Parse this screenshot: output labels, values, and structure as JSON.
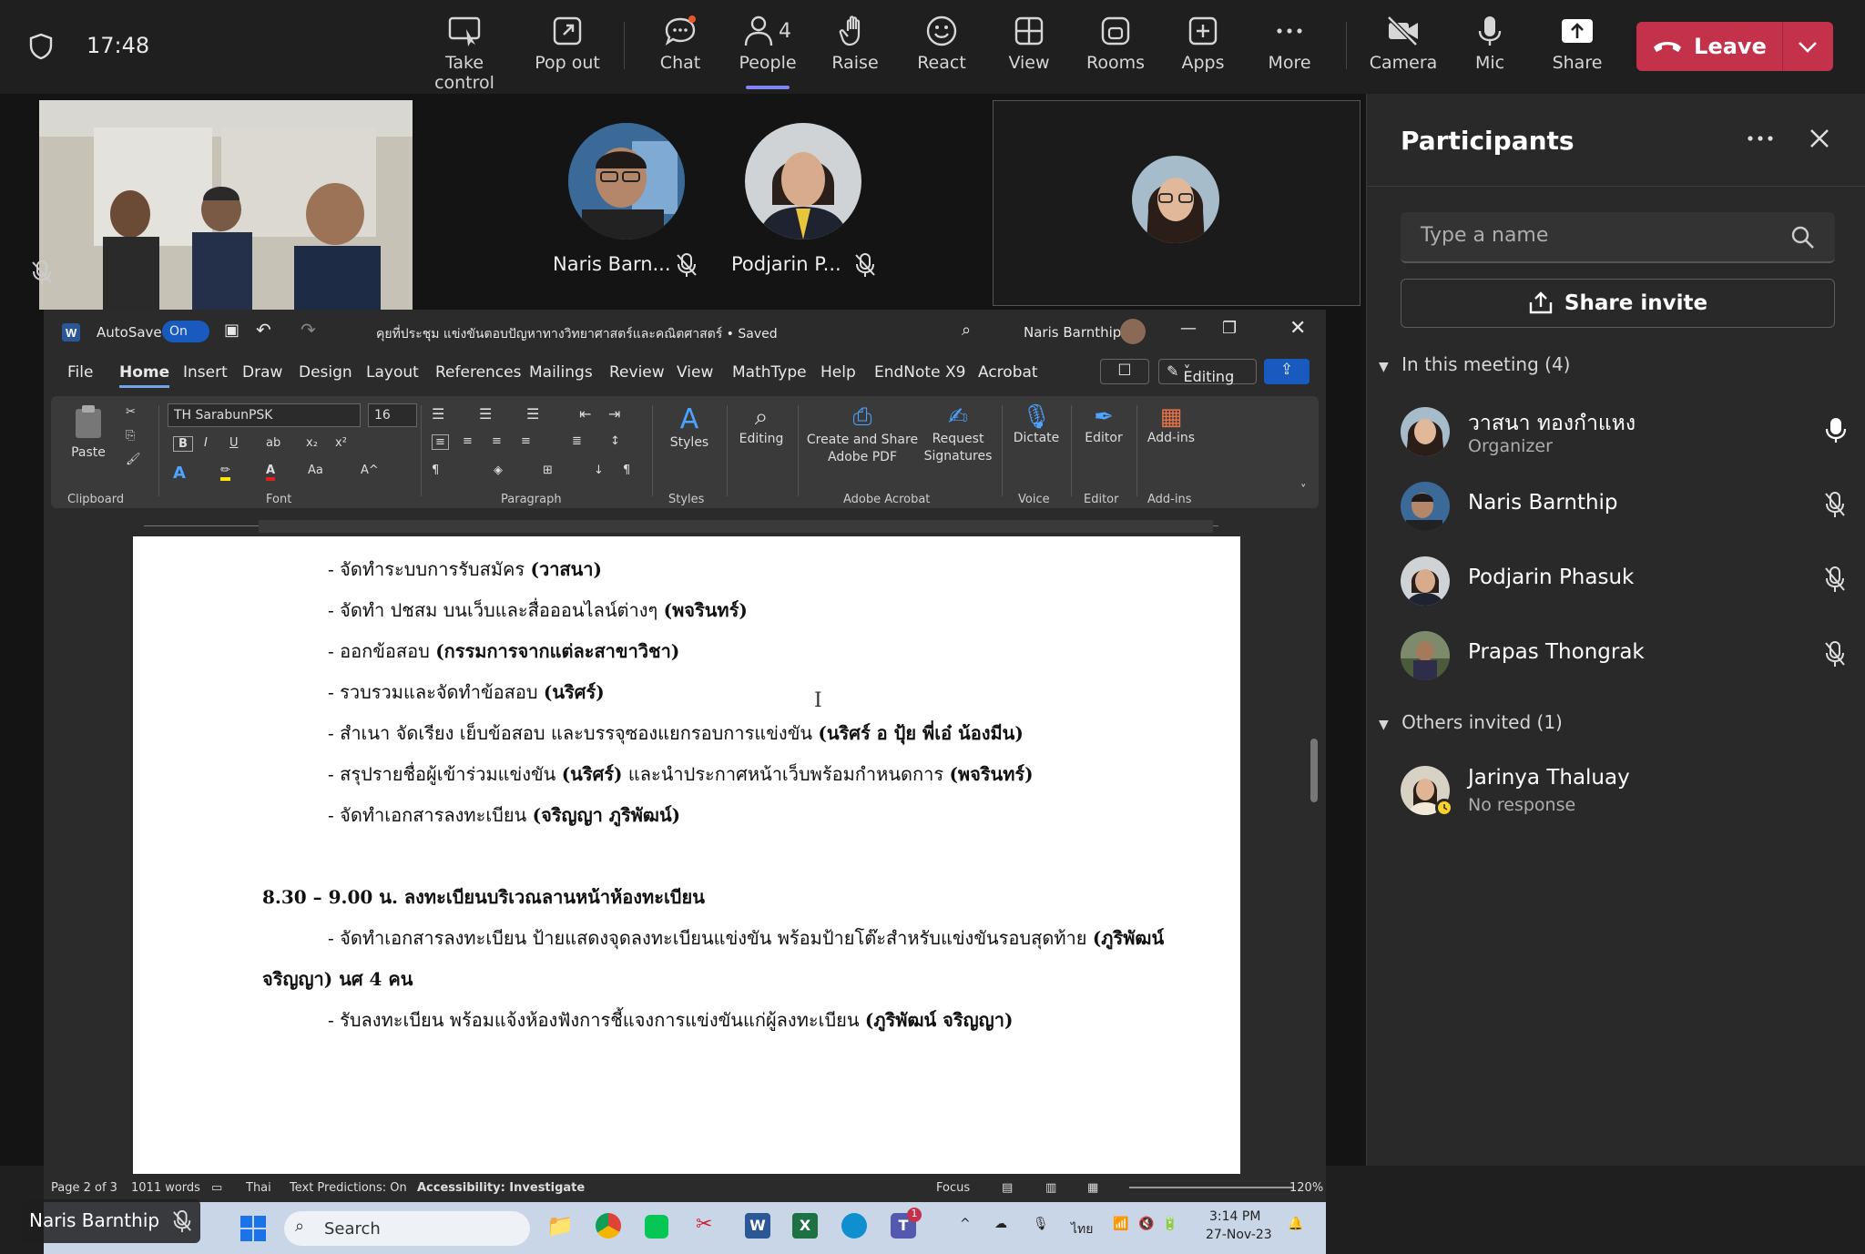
{
  "topbar": {
    "time": "17:48",
    "buttons": [
      {
        "label": "Take control",
        "icon": "take-control-icon"
      },
      {
        "label": "Pop out",
        "icon": "pop-out-icon"
      },
      {
        "label": "Chat",
        "icon": "chat-icon"
      },
      {
        "label": "People",
        "icon": "people-icon",
        "count": "4",
        "selected": true
      },
      {
        "label": "Raise",
        "icon": "raise-hand-icon"
      },
      {
        "label": "React",
        "icon": "react-icon"
      },
      {
        "label": "View",
        "icon": "view-icon"
      },
      {
        "label": "Rooms",
        "icon": "rooms-icon"
      },
      {
        "label": "Apps",
        "icon": "apps-icon"
      },
      {
        "label": "More",
        "icon": "more-icon"
      },
      {
        "label": "Camera",
        "icon": "camera-off-icon"
      },
      {
        "label": "Mic",
        "icon": "mic-icon"
      },
      {
        "label": "Share",
        "icon": "share-icon"
      }
    ],
    "leave_label": "Leave",
    "colors": {
      "leave": "#c4314b",
      "accent": "#7f85f5"
    }
  },
  "stage": {
    "tiles": [
      {
        "name": "Naris Barn..."
      },
      {
        "name": "Podjarin P..."
      }
    ],
    "presenter_badge": "Naris Barnthip"
  },
  "word": {
    "autosave_label": "AutoSave",
    "autosave_state": "On",
    "doc_title": "คุยที่ประชุม แข่งขันตอบปัญหาทางวิทยาศาสตร์และคณิตศาสตร์ • Saved",
    "user_name": "Naris Barnthip",
    "menu": [
      "File",
      "Home",
      "Insert",
      "Draw",
      "Design",
      "Layout",
      "References",
      "Mailings",
      "Review",
      "View",
      "MathType",
      "Help",
      "EndNote X9",
      "Acrobat"
    ],
    "editing_label": "Editing",
    "font_name": "TH SarabunPSK",
    "font_size": "16",
    "ribbon": {
      "paste": "Paste",
      "styles": "Styles",
      "editing": "Editing",
      "create_pdf": "Create and Share Adobe PDF",
      "request_sig": "Request Signatures",
      "dictate": "Dictate",
      "editor": "Editor",
      "addins": "Add-ins",
      "groups": [
        "Clipboard",
        "Font",
        "Paragraph",
        "Styles",
        "Adobe Acrobat",
        "Voice",
        "Editor",
        "Add-ins"
      ]
    },
    "doc_lines": [
      {
        "text": "- จัดทำระบบการรับสมัคร ",
        "bold": "(วาสนา)"
      },
      {
        "text": "- จัดทำ ปชสม บนเว็บและสื่อออนไลน์ต่างๆ ",
        "bold": "(พจรินทร์)"
      },
      {
        "text": "- ออกข้อสอบ ",
        "bold": "(กรรมการจากแต่ละสาขาวิชา)"
      },
      {
        "text": "- รวบรวมและจัดทำข้อสอบ ",
        "bold": "(นริศร์)"
      },
      {
        "text": "- สำเนา จัดเรียง เย็บข้อสอบ และบรรจุซองแยกรอบการแข่งขัน ",
        "bold": "(นริศร์ อ ปุ้ย พี่เอ๋ น้องมีน)"
      },
      {
        "text": "- สรุปรายชื่อผู้เข้าร่วมแข่งขัน ",
        "bold": "(นริศร์)",
        "text2": " และนำประกาศหน้าเว็บพร้อมกำหนดการ ",
        "bold2": "(พจรินทร์)"
      },
      {
        "text": "- จัดทำเอกสารลงทะเบียน ",
        "bold": "(จริญญา ภูริพัฒน์)"
      }
    ],
    "heading": "8.30 – 9.00 น. ลงทะเบียนบริเวณลานหน้าห้องทะเบียน",
    "doc_lines2": [
      {
        "text": "- จัดทำเอกสารลงทะเบียน ป้ายแสดงจุดลงทะเบียนแข่งขัน พร้อมป้ายโต๊ะสำหรับแข่งขันรอบสุดท้าย ",
        "bold": "(ภูริพัฒน์"
      },
      {
        "text": "",
        "bold": "จริญญา)",
        "text2": " นศ 4 คน"
      },
      {
        "text": "- รับลงทะเบียน พร้อมแจ้งห้องฟังการชี้แจงการแข่งขันแก่ผู้ลงทะเบียน ",
        "bold": "(ภูริพัฒน์ จริญญา)"
      }
    ],
    "status": {
      "page": "Page 2 of 3",
      "words": "1011 words",
      "lang": "Thai",
      "predictions": "Text Predictions: On",
      "accessibility": "Accessibility: Investigate",
      "focus": "Focus",
      "zoom": "120%"
    }
  },
  "taskbar": {
    "search": "Search",
    "lang": "ไทย",
    "time": "3:14 PM",
    "date": "27-Nov-23",
    "teams_badge": "1"
  },
  "panel": {
    "title": "Participants",
    "search_placeholder": "Type a name",
    "share_invite": "Share invite",
    "in_meeting_label": "In this meeting (4)",
    "participants": [
      {
        "name": "วาสนา ทองกำแหง",
        "role": "Organizer",
        "mic": "on"
      },
      {
        "name": "Naris Barnthip",
        "role": "",
        "mic": "muted"
      },
      {
        "name": "Podjarin Phasuk",
        "role": "",
        "mic": "muted"
      },
      {
        "name": "Prapas Thongrak",
        "role": "",
        "mic": "muted"
      }
    ],
    "others_label": "Others invited (1)",
    "invited": [
      {
        "name": "Jarinya Thaluay",
        "role": "No response"
      }
    ]
  }
}
